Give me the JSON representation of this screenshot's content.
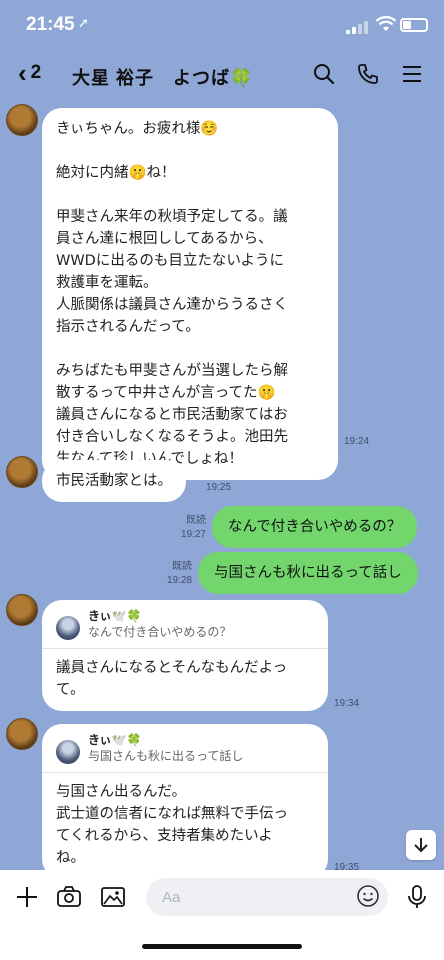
{
  "status": {
    "time": "21:45",
    "location_glyph": "➚"
  },
  "header": {
    "back_count": "2",
    "title": "大星 裕子　よつば🍀"
  },
  "messages": {
    "m1": {
      "lines": [
        "きぃちゃん。お疲れ様☺️",
        "",
        "絶対に内緒🤫ね！",
        "",
        "甲斐さん来年の秋頃予定してる。議",
        "員さん達に根回ししてあるから、",
        "WWDに出るのも目立たないように",
        "救護車を運転。",
        "人脈関係は議員さん達からうるさく",
        "指示されるんだって。",
        "",
        "みちばたも甲斐さんが当選したら解",
        "散するって中井さんが言ってた🤫",
        "議員さんになると市民活動家てはお",
        "付き合いしなくなるそうよ。池田先",
        "生なんて珍しいんでしょね！"
      ],
      "time": "19:24"
    },
    "m2": {
      "text": "市民活動家とは。",
      "time": "19:25"
    },
    "m3": {
      "read": "既読",
      "time": "19:27",
      "text": "なんで付き合いやめるの？"
    },
    "m4": {
      "read": "既読",
      "time": "19:28",
      "text": "与国さんも秋に出るって話し"
    },
    "m5": {
      "reply_name": "きぃ🕊️🍀",
      "reply_text": "なんで付き合いやめるの？",
      "lines": [
        "議員さんになるとそんなもんだよっ",
        "て。"
      ],
      "time": "19:34"
    },
    "m6": {
      "reply_name": "きぃ🕊️🍀",
      "reply_text": "与国さんも秋に出るって話し",
      "lines": [
        "与国さん出るんだ。",
        "武士道の信者になれば無料で手伝っ",
        "てくれるから、支持者集めたいよ",
        "ね。"
      ],
      "time": "19:35"
    }
  },
  "input": {
    "placeholder": "Aa"
  },
  "colors": {
    "background": "#8fa7d6",
    "sent_bubble": "#72d66d",
    "received_bubble": "#ffffff"
  }
}
